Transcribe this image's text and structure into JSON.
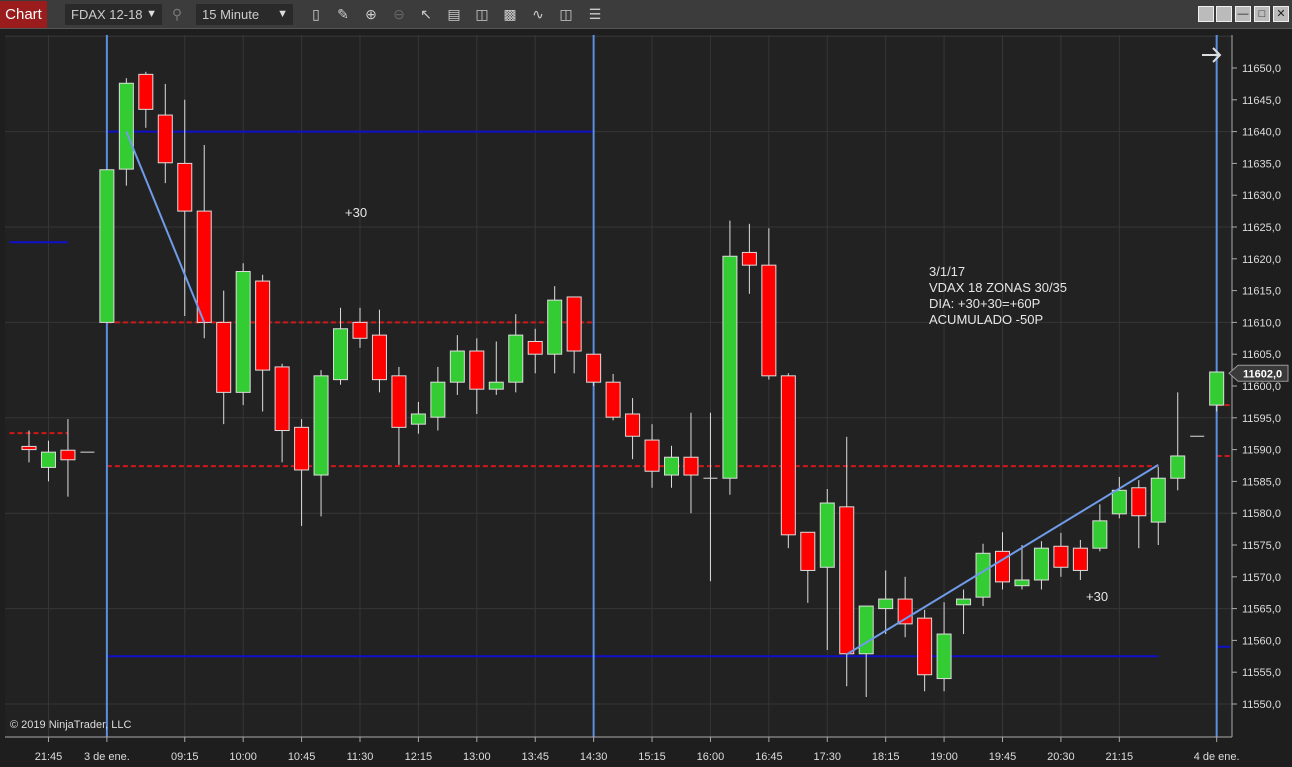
{
  "toolbar": {
    "chart_tab": "Chart",
    "instrument": "FDAX 12-18",
    "interval": "15 Minute",
    "icons": [
      "search-icon",
      "bar-type-icon",
      "draw-tool-icon",
      "zoom-in-icon",
      "zoom-out-icon",
      "pointer-icon",
      "data-box-icon",
      "properties-icon",
      "indicators-icon",
      "strategies-icon",
      "templates-icon",
      "menu-list-icon"
    ]
  },
  "window_buttons": [
    "link-button",
    "link-button-2",
    "minimize-button",
    "maximize-button",
    "close-button"
  ],
  "copyright": "© 2019 NinjaTrader, LLC",
  "annotations": {
    "left_pnl": "+30",
    "right_pnl": "+30",
    "note": [
      "3/1/17",
      "VDAX 18 ZONAS 30/35",
      "DIA: +30+30=+60P",
      "ACUMULADO -50P"
    ]
  },
  "colors": {
    "up": "#33cc33",
    "down": "#ff0000",
    "background": "#222222",
    "zone_blue": "#1010c8",
    "dash_red": "#d01818",
    "vline": "#5b8fe0"
  },
  "chart_data": {
    "type": "candlestick",
    "ylim": [
      11546,
      11660
    ],
    "y_ticks": [
      "11550,0",
      "11555,0",
      "11560,0",
      "11565,0",
      "11570,0",
      "11575,0",
      "11580,0",
      "11585,0",
      "11590,0",
      "11595,0",
      "11600,0",
      "11605,0",
      "11610,0",
      "11615,0",
      "11620,0",
      "11625,0",
      "11630,0",
      "11635,0",
      "11640,0",
      "11645,0",
      "11650,0"
    ],
    "y_tick_values": [
      11550,
      11555,
      11560,
      11565,
      11570,
      11575,
      11580,
      11585,
      11590,
      11595,
      11600,
      11605,
      11610,
      11615,
      11620,
      11625,
      11630,
      11635,
      11640,
      11645,
      11650
    ],
    "last_price_label": "11602,0",
    "last_price": 11602,
    "x_ticks": [
      {
        "label": "21:45",
        "bar": 1
      },
      {
        "label": "3 de ene.",
        "bar": 4
      },
      {
        "label": "09:15",
        "bar": 8
      },
      {
        "label": "10:00",
        "bar": 11
      },
      {
        "label": "10:45",
        "bar": 14
      },
      {
        "label": "11:30",
        "bar": 17
      },
      {
        "label": "12:15",
        "bar": 20
      },
      {
        "label": "13:00",
        "bar": 23
      },
      {
        "label": "13:45",
        "bar": 26
      },
      {
        "label": "14:30",
        "bar": 29
      },
      {
        "label": "15:15",
        "bar": 32
      },
      {
        "label": "16:00",
        "bar": 35
      },
      {
        "label": "16:45",
        "bar": 38
      },
      {
        "label": "17:30",
        "bar": 41
      },
      {
        "label": "18:15",
        "bar": 44
      },
      {
        "label": "19:00",
        "bar": 47
      },
      {
        "label": "19:45",
        "bar": 50
      },
      {
        "label": "20:30",
        "bar": 53
      },
      {
        "label": "21:15",
        "bar": 56
      },
      {
        "label": "4 de ene.",
        "bar": 61
      }
    ],
    "ohlc": [
      [
        11590.5,
        11593,
        11588,
        11590
      ],
      [
        11587.2,
        11591.4,
        11585,
        11589.6
      ],
      [
        11589.9,
        11594.8,
        11582.6,
        11588.4
      ],
      [
        11589.6,
        11589.6,
        11589.6,
        11589.6
      ],
      [
        11610,
        11634,
        11610,
        11634
      ],
      [
        11634.1,
        11648.4,
        11631.5,
        11647.6
      ],
      [
        11649,
        11649.4,
        11640.6,
        11643.5
      ],
      [
        11642.6,
        11647.5,
        11631.9,
        11635.1
      ],
      [
        11635,
        11645,
        11611,
        11627.5
      ],
      [
        11627.5,
        11637.9,
        11607.5,
        11610
      ],
      [
        11610,
        11615,
        11594,
        11599
      ],
      [
        11599,
        11619.3,
        11597,
        11618
      ],
      [
        11616.5,
        11617.5,
        11596,
        11602.5
      ],
      [
        11603,
        11603.5,
        11588,
        11593
      ],
      [
        11593.5,
        11594.8,
        11578,
        11586.8
      ],
      [
        11586,
        11602.5,
        11579.5,
        11601.6
      ],
      [
        11601,
        11612.3,
        11600.2,
        11609
      ],
      [
        11610,
        11612.3,
        11606,
        11607.5
      ],
      [
        11608,
        11612,
        11599,
        11601
      ],
      [
        11601.6,
        11603,
        11587.6,
        11593.5
      ],
      [
        11594,
        11597.5,
        11592.5,
        11595.6
      ],
      [
        11595.1,
        11603,
        11593,
        11600.6
      ],
      [
        11600.6,
        11608,
        11598.6,
        11605.5
      ],
      [
        11605.5,
        11607.5,
        11595.6,
        11599.5
      ],
      [
        11599.5,
        11607,
        11598.6,
        11600.6
      ],
      [
        11600.6,
        11611.3,
        11599,
        11608
      ],
      [
        11607,
        11609,
        11602,
        11605
      ],
      [
        11605,
        11615.7,
        11602,
        11613.5
      ],
      [
        11614,
        11614,
        11602,
        11605.5
      ],
      [
        11605,
        11605,
        11600,
        11600.6
      ],
      [
        11600.6,
        11601.9,
        11594.6,
        11595.1
      ],
      [
        11595.6,
        11598.1,
        11588.5,
        11592.1
      ],
      [
        11591.5,
        11594,
        11584,
        11586.6
      ],
      [
        11586,
        11590.6,
        11584,
        11588.8
      ],
      [
        11588.8,
        11595.8,
        11580,
        11586
      ],
      [
        11585.5,
        11595.8,
        11569.3,
        11585.5
      ],
      [
        11585.5,
        11626,
        11582.9,
        11620.4
      ],
      [
        11621,
        11625.5,
        11614.5,
        11619
      ],
      [
        11619,
        11624.8,
        11601,
        11601.6
      ],
      [
        11601.6,
        11602,
        11574.5,
        11576.6
      ],
      [
        11577,
        11577,
        11565.9,
        11571
      ],
      [
        11571.5,
        11583.8,
        11558.5,
        11581.6
      ],
      [
        11581,
        11592,
        11552.8,
        11557.9
      ],
      [
        11557.9,
        11565.4,
        11551.1,
        11565.4
      ],
      [
        11565,
        11571,
        11561,
        11566.5
      ],
      [
        11566.5,
        11570,
        11560.5,
        11562.6
      ],
      [
        11563.5,
        11564.8,
        11552,
        11554.6
      ],
      [
        11554,
        11566,
        11552,
        11561
      ],
      [
        11565.6,
        11568,
        11561,
        11566.5
      ],
      [
        11566.8,
        11575.2,
        11565.4,
        11573.7
      ],
      [
        11574,
        11577,
        11568,
        11569.2
      ],
      [
        11568.6,
        11575,
        11568,
        11569.5
      ],
      [
        11569.5,
        11575.6,
        11568,
        11574.5
      ],
      [
        11574.8,
        11576.9,
        11570,
        11571.5
      ],
      [
        11574.5,
        11575.8,
        11569.5,
        11571
      ],
      [
        11574.5,
        11581.4,
        11574,
        11578.8
      ],
      [
        11579.9,
        11585.7,
        11579.2,
        11583.6
      ],
      [
        11584,
        11585.2,
        11574.5,
        11579.6
      ],
      [
        11578.6,
        11587.3,
        11575,
        11585.5
      ],
      [
        11585.5,
        11599,
        11583.6,
        11589
      ],
      [
        11592.1,
        11592.1,
        11592.1,
        11592.1
      ],
      [
        11597,
        11602.2,
        11596,
        11602.2
      ]
    ],
    "horizontal_lines": [
      {
        "price": 11640,
        "from_bar": 4,
        "to_bar": 29,
        "style": "solid-blue"
      },
      {
        "price": 11557.5,
        "from_bar": 4,
        "to_bar": 58,
        "style": "solid-blue"
      },
      {
        "price": 11622.6,
        "from_bar": -1,
        "to_bar": 2,
        "style": "solid-blue"
      },
      {
        "price": 11610,
        "from_bar": 4,
        "to_bar": 29,
        "style": "dash-red"
      },
      {
        "price": 11587.4,
        "from_bar": 4,
        "to_bar": 58,
        "style": "dash-red"
      },
      {
        "price": 11592.6,
        "from_bar": -1,
        "to_bar": 2,
        "style": "dash-red"
      },
      {
        "price": 11597,
        "from_bar": 61,
        "to_bar": 61.7,
        "style": "dash-red"
      },
      {
        "price": 11589,
        "from_bar": 61,
        "to_bar": 61.7,
        "style": "dash-red"
      },
      {
        "price": 11559,
        "from_bar": 61,
        "to_bar": 61.7,
        "style": "solid-blue"
      }
    ],
    "vertical_lines_bars": [
      4,
      29,
      61
    ],
    "trend_lines": [
      {
        "from": [
          5,
          11640
        ],
        "to": [
          9,
          11610
        ]
      },
      {
        "from": [
          42,
          11557.8
        ],
        "to": [
          58,
          11587.6
        ]
      }
    ]
  }
}
